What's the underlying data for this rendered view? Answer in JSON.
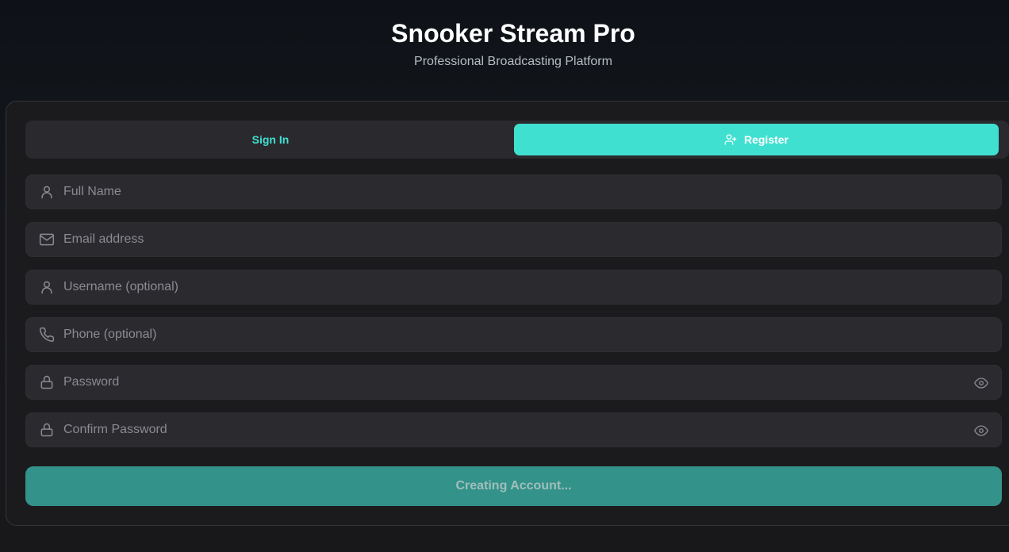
{
  "header": {
    "title": "Snooker Stream Pro",
    "subtitle": "Professional Broadcasting Platform"
  },
  "tabs": {
    "signin_label": "Sign In",
    "register_label": "Register",
    "active": "register"
  },
  "form": {
    "full_name": {
      "placeholder": "Full Name",
      "value": "",
      "icon": "user-icon"
    },
    "email": {
      "placeholder": "Email address",
      "value": "",
      "icon": "mail-icon"
    },
    "username": {
      "placeholder": "Username (optional)",
      "value": "",
      "icon": "user-icon"
    },
    "phone": {
      "placeholder": "Phone (optional)",
      "value": "",
      "icon": "phone-icon"
    },
    "password": {
      "placeholder": "Password",
      "value": "",
      "icon": "lock-icon",
      "toggle_icon": "eye-icon"
    },
    "confirm_password": {
      "placeholder": "Confirm Password",
      "value": "",
      "icon": "lock-icon",
      "toggle_icon": "eye-icon"
    }
  },
  "submit": {
    "label": "Creating Account...",
    "state": "loading"
  },
  "colors": {
    "accent": "#40e0d0",
    "submit_bg": "#33928a",
    "card_bg": "#1b1b1e",
    "field_bg": "#2b2b2f"
  }
}
